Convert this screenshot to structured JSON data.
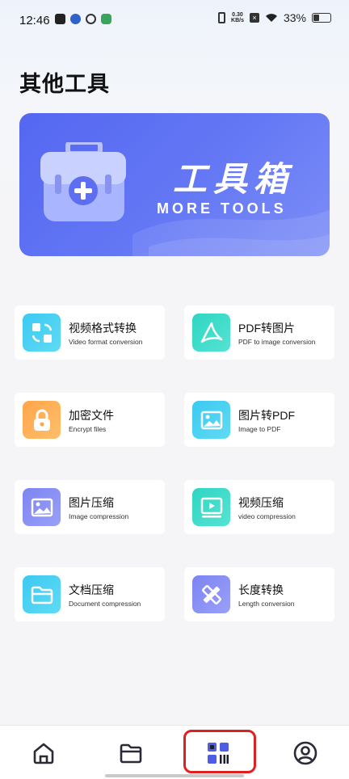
{
  "status_bar": {
    "time": "12:46",
    "net_speed_value": "0.30",
    "net_speed_unit": "KB/s",
    "battery": "33%"
  },
  "page_title": "其他工具",
  "banner": {
    "title": "工具箱",
    "subtitle": "MORE TOOLS"
  },
  "tools": [
    {
      "name": "视频格式转换",
      "sub": "Video format conversion",
      "icon": "video-convert-icon"
    },
    {
      "name": "PDF转图片",
      "sub": "PDF to image conversion",
      "icon": "pdf-icon"
    },
    {
      "name": "加密文件",
      "sub": "Encrypt files",
      "icon": "lock-icon"
    },
    {
      "name": "图片转PDF",
      "sub": "Image to PDF",
      "icon": "image-icon"
    },
    {
      "name": "图片压缩",
      "sub": "Image compression",
      "icon": "image-icon"
    },
    {
      "name": "视频压缩",
      "sub": "video compression",
      "icon": "video-play-icon"
    },
    {
      "name": "文档压缩",
      "sub": "Document compression",
      "icon": "folder-icon"
    },
    {
      "name": "长度转换",
      "sub": "Length conversion",
      "icon": "ruler-pencil-icon"
    }
  ],
  "bottom_nav": [
    {
      "icon": "home-icon",
      "active": false
    },
    {
      "icon": "folder-icon",
      "active": false
    },
    {
      "icon": "tools-grid-icon",
      "active": true
    },
    {
      "icon": "profile-icon",
      "active": false
    }
  ],
  "colors": {
    "banner": "#5a6cf2",
    "cyan": "#3cc9f2",
    "teal": "#2fd6c3",
    "orange": "#ffa64b",
    "purple": "#7d84f3",
    "highlight": "#e0201f",
    "nav_active": "#4e5de6"
  }
}
